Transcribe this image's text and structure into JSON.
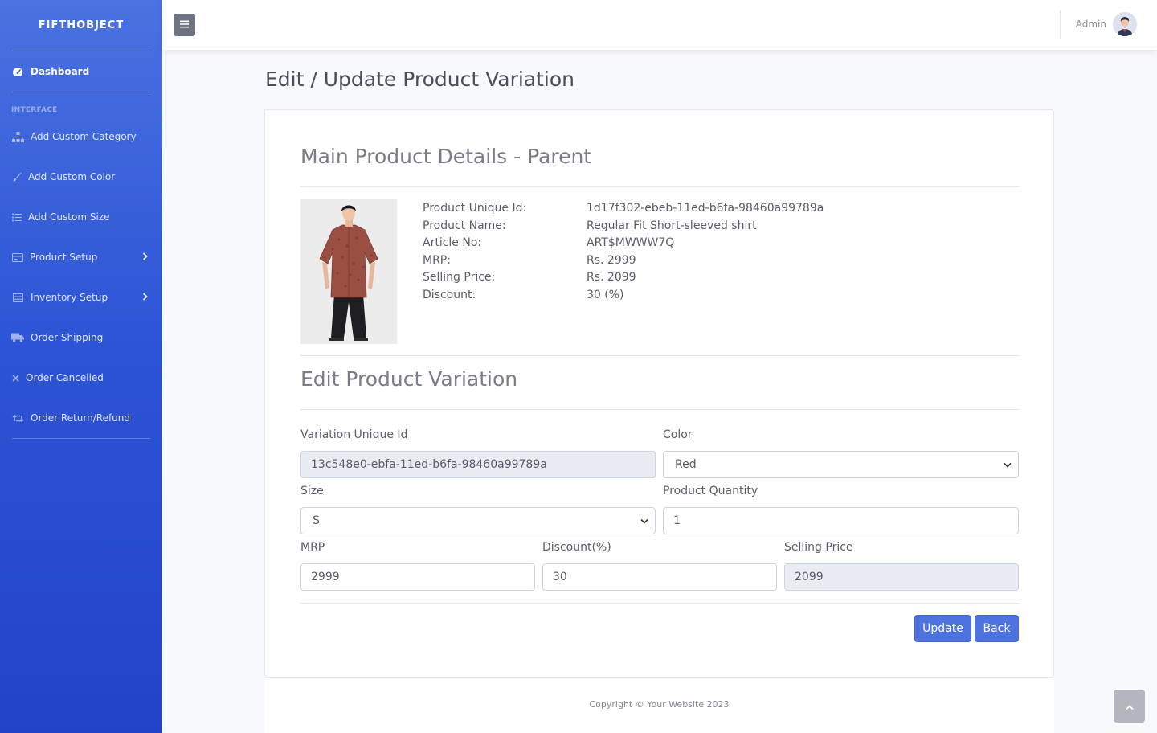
{
  "sidebar": {
    "brand": "FIFTHOBJECT",
    "dashboard": "Dashboard",
    "section_heading": "INTERFACE",
    "items": [
      {
        "label": "Add Custom Category",
        "icon": "sitemap-icon"
      },
      {
        "label": "Add Custom Color",
        "icon": "paint-brush-icon"
      },
      {
        "label": "Add Custom Size",
        "icon": "list-icon"
      },
      {
        "label": "Product Setup",
        "icon": "card-icon",
        "has_submenu": true
      },
      {
        "label": "Inventory Setup",
        "icon": "table-icon",
        "has_submenu": true
      },
      {
        "label": "Order Shipping",
        "icon": "truck-icon"
      },
      {
        "label": "Order Cancelled",
        "icon": "times-icon"
      },
      {
        "label": "Order Return/Refund",
        "icon": "retweet-icon"
      }
    ]
  },
  "topbar": {
    "toggle_icon": "hamburger-icon",
    "user_name": "Admin"
  },
  "page": {
    "title": "Edit / Update Product Variation"
  },
  "parent": {
    "heading": "Main Product Details - Parent",
    "fields": [
      {
        "label": "Product Unique Id:",
        "value": "1d17f302-ebeb-11ed-b6fa-98460a99789a"
      },
      {
        "label": "Product Name:",
        "value": "Regular Fit Short-sleeved shirt"
      },
      {
        "label": "Article No:",
        "value": "ART$MWWW7Q"
      },
      {
        "label": "MRP:",
        "value": "Rs. 2999"
      },
      {
        "label": "Selling Price:",
        "value": "Rs. 2099"
      },
      {
        "label": "Discount:",
        "value": "30 (%)"
      }
    ]
  },
  "variation": {
    "heading": "Edit Product Variation",
    "unique_id_label": "Variation Unique Id",
    "unique_id_value": "13c548e0-ebfa-11ed-b6fa-98460a99789a",
    "color_label": "Color",
    "color_value": "Red",
    "size_label": "Size",
    "size_value": "S",
    "quantity_label": "Product Quantity",
    "quantity_value": "1",
    "mrp_label": "MRP",
    "mrp_value": "2999",
    "discount_label": "Discount(%)",
    "discount_value": "30",
    "selling_label": "Selling Price",
    "selling_value": "2099",
    "update_label": "Update",
    "back_label": "Back"
  },
  "footer": {
    "text": "Copyright © Your Website 2023"
  },
  "colors": {
    "primary": "#4e73df",
    "sidebar_top": "#4a72e0",
    "sidebar_bottom": "#2243c6"
  }
}
